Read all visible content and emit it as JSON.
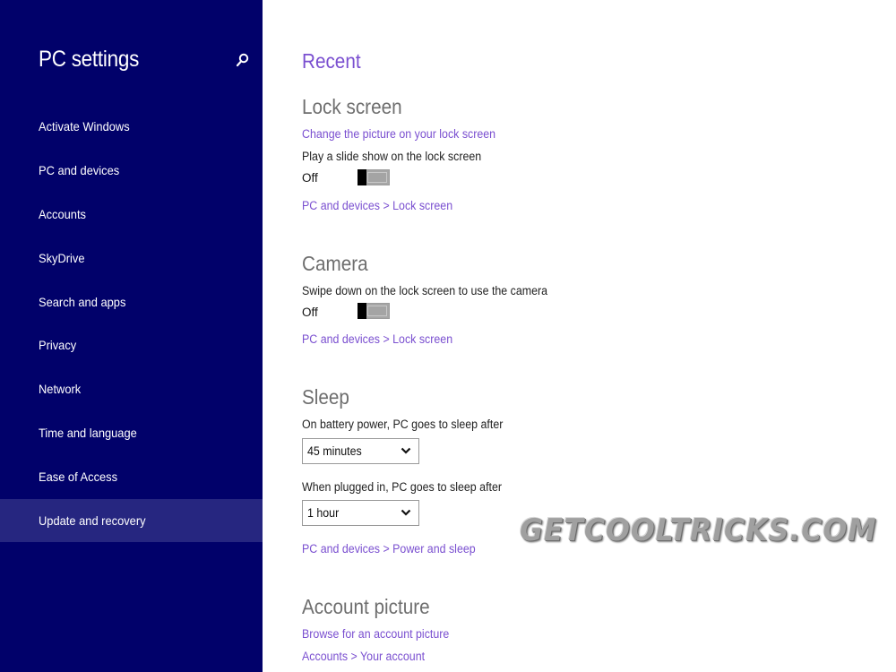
{
  "sidebar": {
    "title": "PC settings",
    "search_icon": "search-icon",
    "items": [
      {
        "label": "Activate Windows",
        "selected": false
      },
      {
        "label": "PC and devices",
        "selected": false
      },
      {
        "label": "Accounts",
        "selected": false
      },
      {
        "label": "SkyDrive",
        "selected": false
      },
      {
        "label": "Search and apps",
        "selected": false
      },
      {
        "label": "Privacy",
        "selected": false
      },
      {
        "label": "Network",
        "selected": false
      },
      {
        "label": "Time and language",
        "selected": false
      },
      {
        "label": "Ease of Access",
        "selected": false
      },
      {
        "label": "Update and recovery",
        "selected": true
      }
    ]
  },
  "main": {
    "heading": "Recent",
    "lock_screen": {
      "title": "Lock screen",
      "change_picture_link": "Change the picture on your lock screen",
      "slideshow_label": "Play a slide show on the lock screen",
      "slideshow_state": "Off",
      "breadcrumb_link": "PC and devices > Lock screen"
    },
    "camera": {
      "title": "Camera",
      "label": "Swipe down on the lock screen to use the camera",
      "state": "Off",
      "breadcrumb_link": "PC and devices > Lock screen"
    },
    "sleep": {
      "title": "Sleep",
      "battery_label": "On battery power, PC goes to sleep after",
      "battery_value": "45 minutes",
      "plugged_label": "When plugged in, PC goes to sleep after",
      "plugged_value": "1 hour",
      "breadcrumb_link": "PC and devices > Power and sleep"
    },
    "account_picture": {
      "title": "Account picture",
      "browse_link": "Browse for an account picture",
      "breadcrumb_link": "Accounts > Your account"
    }
  },
  "watermark": "GETCOOLTRICKS.COM",
  "colors": {
    "sidebar_bg": "#01016a",
    "sidebar_selected": "#262680",
    "accent_link": "#7a4fd0",
    "heading_gray": "#6e6e6e"
  }
}
